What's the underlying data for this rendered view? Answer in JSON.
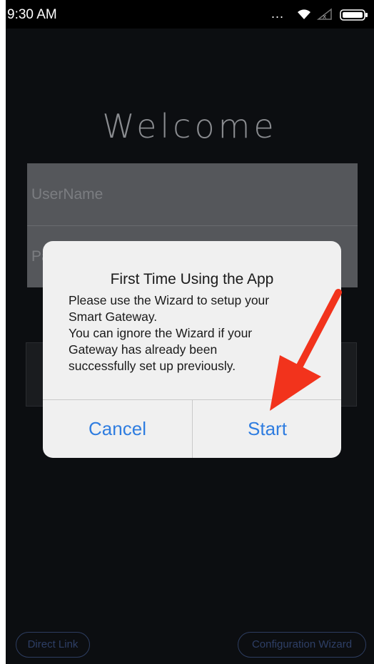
{
  "status_bar": {
    "time": "9:30 AM",
    "dots": "...",
    "icons": [
      "wifi-icon",
      "signal-icon",
      "battery-icon"
    ]
  },
  "login": {
    "title": "Welcome",
    "username_placeholder": "UserName",
    "password_placeholder": "Password"
  },
  "bottom_links": {
    "left": "Direct Link",
    "right": "Configuration Wizard"
  },
  "dialog": {
    "title": "First Time Using the App",
    "message_lines": [
      "Please use the Wizard to setup your",
      "Smart Gateway.",
      "You can ignore the Wizard if your",
      "Gateway has already been",
      "successfully set up previously."
    ],
    "cancel_label": "Cancel",
    "start_label": "Start"
  },
  "colors": {
    "accent": "#2f7de0",
    "annotation_arrow": "#f2331c",
    "background": "#0c0e11"
  }
}
